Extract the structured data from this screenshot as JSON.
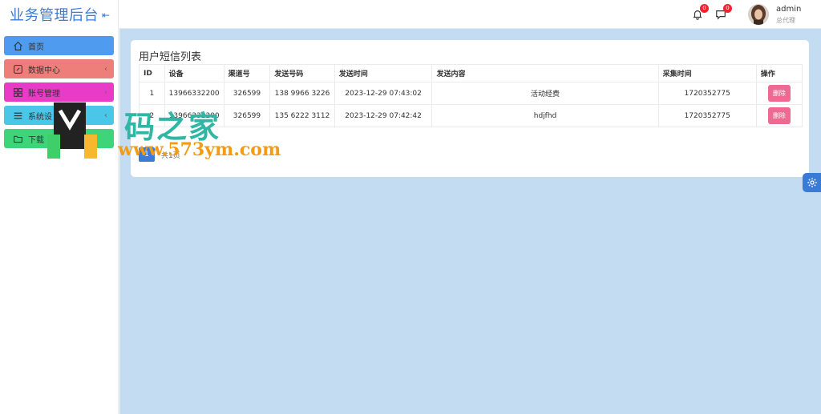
{
  "app": {
    "title": "业务管理后台"
  },
  "sidebar": {
    "items": [
      {
        "label": "首页",
        "color": "#4f9bf0",
        "icon": "home-icon",
        "has_arrow": false
      },
      {
        "label": "数据中心",
        "color": "#ee7e7a",
        "icon": "edit-icon",
        "has_arrow": true
      },
      {
        "label": "账号管理",
        "color": "#e83cc8",
        "icon": "grid-icon",
        "has_arrow": true
      },
      {
        "label": "系统设",
        "color": "#4ac6e8",
        "icon": "menu-icon",
        "has_arrow": true
      },
      {
        "label": "下载",
        "color": "#3ed47a",
        "icon": "folder-icon",
        "has_arrow": false
      }
    ]
  },
  "header": {
    "notification_count": "0",
    "message_count": "0",
    "user_name": "admin",
    "user_role": "总代理"
  },
  "main": {
    "card_title": "用户短信列表",
    "table": {
      "columns": [
        "ID",
        "设备",
        "渠道号",
        "发送号码",
        "发送时间",
        "发送内容",
        "采集时间",
        "操作"
      ],
      "rows": [
        {
          "id": "1",
          "device": "13966332200",
          "channel": "326599",
          "phone": "138 9966 3226",
          "send_time": "2023-12-29 07:43:02",
          "content": "活动经费",
          "collect_time": "1720352775",
          "action": "删除"
        },
        {
          "id": "2",
          "device": "13966332200",
          "channel": "326599",
          "phone": "135 6222 3112",
          "send_time": "2023-12-29 07:42:42",
          "content": "hdjfhd",
          "collect_time": "1720352775",
          "action": "删除"
        }
      ]
    },
    "pager": {
      "current_page": "1",
      "total_text": "共1页"
    }
  },
  "watermark": {
    "cn_text": "码之家",
    "url_text": "www.573ym.com"
  },
  "colors": {
    "accent": "#3a7bd5",
    "main_bg": "#c4dcf2",
    "delete_button": "#ee6a93",
    "badge": "#f5222d"
  }
}
